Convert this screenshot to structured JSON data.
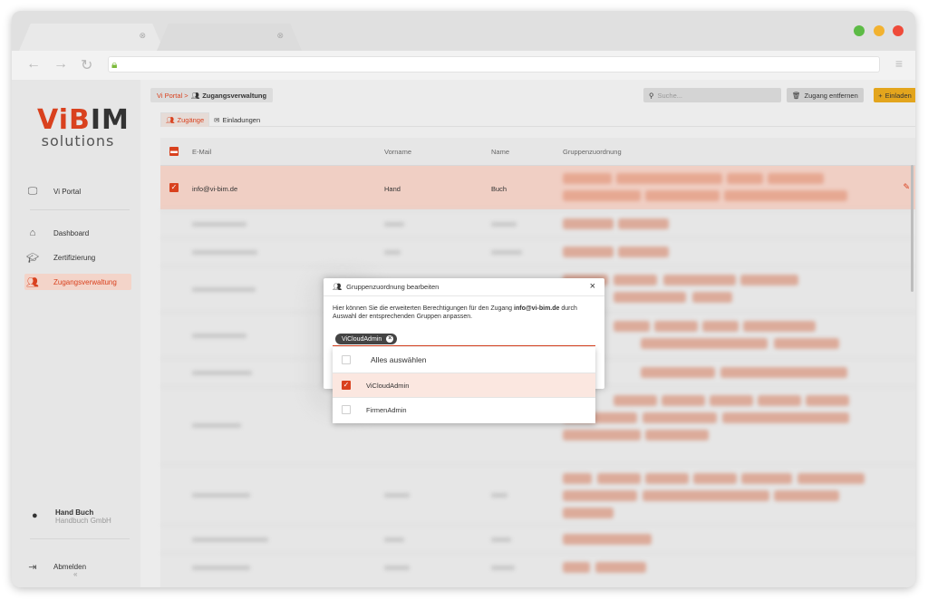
{
  "window": {
    "traffic_lights": [
      "#5dbb46",
      "#f2b230",
      "#ef4b3a"
    ]
  },
  "sidebar": {
    "logo_main_left": "ViB",
    "logo_main_right": "IM",
    "logo_sub": "solutions",
    "portal_label": "Vi Portal",
    "items": [
      {
        "label": "Dashboard",
        "icon": "home-icon"
      },
      {
        "label": "Zertifizierung",
        "icon": "graduation-cap-icon"
      },
      {
        "label": "Zugangsverwaltung",
        "icon": "users-icon",
        "active": true
      }
    ],
    "user": {
      "name": "Hand Buch",
      "company": "Handbuch GmbH"
    },
    "logout_label": "Abmelden",
    "collapse_label": "«"
  },
  "header": {
    "breadcrumb_root": "Vi Portal >",
    "breadcrumb_current": "Zugangsverwaltung",
    "search_placeholder": "Suche...",
    "remove_button": "Zugang entfernen",
    "invite_button": "Einladen"
  },
  "tabs": [
    {
      "label": "Zugänge",
      "active": true
    },
    {
      "label": "Einladungen",
      "active": false
    }
  ],
  "table": {
    "columns": [
      "E-Mail",
      "Vorname",
      "Name",
      "Gruppenzuordnung"
    ],
    "selected_row": {
      "email": "info@vi-bim.de",
      "vorname": "Hand",
      "name": "Buch"
    }
  },
  "modal": {
    "title": "Gruppenzuordnung bearbeiten",
    "close": "×",
    "text_before": "Hier können Sie die erweiterten Berechtigungen für den Zugang ",
    "text_bold": "info@vi-bim.de",
    "text_after": " durch Auswahl der entsprechenden Gruppen anpassen.",
    "selected_tag": "ViCloudAdmin",
    "options": {
      "select_all": "Alles auswählen",
      "items": [
        {
          "label": "ViCloudAdmin",
          "checked": true
        },
        {
          "label": "FirmenAdmin",
          "checked": false
        }
      ]
    }
  },
  "colors": {
    "accent": "#d9411e",
    "invite": "#e3a51d"
  }
}
